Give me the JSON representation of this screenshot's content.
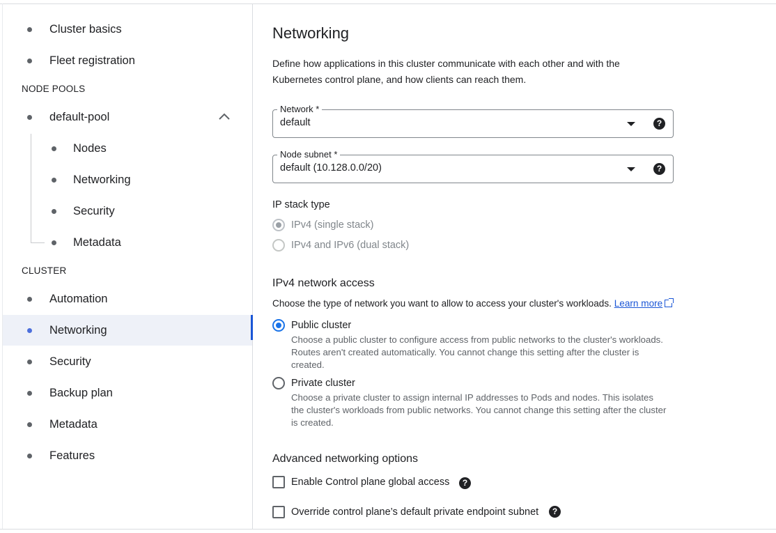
{
  "sidebar": {
    "items": [
      {
        "label": "Cluster basics"
      },
      {
        "label": "Fleet registration"
      }
    ],
    "node_pools_header": "NODE POOLS",
    "pool": {
      "label": "default-pool"
    },
    "pool_items": [
      {
        "label": "Nodes"
      },
      {
        "label": "Networking"
      },
      {
        "label": "Security"
      },
      {
        "label": "Metadata"
      }
    ],
    "cluster_header": "CLUSTER",
    "cluster_items": [
      {
        "label": "Automation"
      },
      {
        "label": "Networking",
        "active": true
      },
      {
        "label": "Security"
      },
      {
        "label": "Backup plan"
      },
      {
        "label": "Metadata"
      },
      {
        "label": "Features"
      }
    ]
  },
  "main": {
    "title": "Networking",
    "description": "Define how applications in this cluster communicate with each other and with the Kubernetes control plane, and how clients can reach them.",
    "network": {
      "label": "Network *",
      "value": "default"
    },
    "node_subnet": {
      "label": "Node subnet *",
      "value": "default (10.128.0.0/20)"
    },
    "ip_stack": {
      "heading": "IP stack type",
      "option1": "IPv4 (single stack)",
      "option2": "IPv4 and IPv6 (dual stack)"
    },
    "access": {
      "heading": "IPv4 network access",
      "description": "Choose the type of network you want to allow to access your cluster's workloads.",
      "learn_more": "Learn more",
      "public_label": "Public cluster",
      "public_desc": "Choose a public cluster to configure access from public networks to the cluster's workloads. Routes aren't created automatically. You cannot change this setting after the cluster is created.",
      "private_label": "Private cluster",
      "private_desc": "Choose a private cluster to assign internal IP addresses to Pods and nodes. This isolates the cluster's workloads from public networks. You cannot change this setting after the cluster is created."
    },
    "advanced": {
      "heading": "Advanced networking options",
      "global_access": "Enable Control plane global access",
      "override_subnet": "Override control plane’s default private endpoint subnet"
    },
    "help_glyph": "?"
  },
  "colors": {
    "accent": "#1a73e8",
    "active_bg": "#eef1f8",
    "indicator": "#1a56d6"
  }
}
